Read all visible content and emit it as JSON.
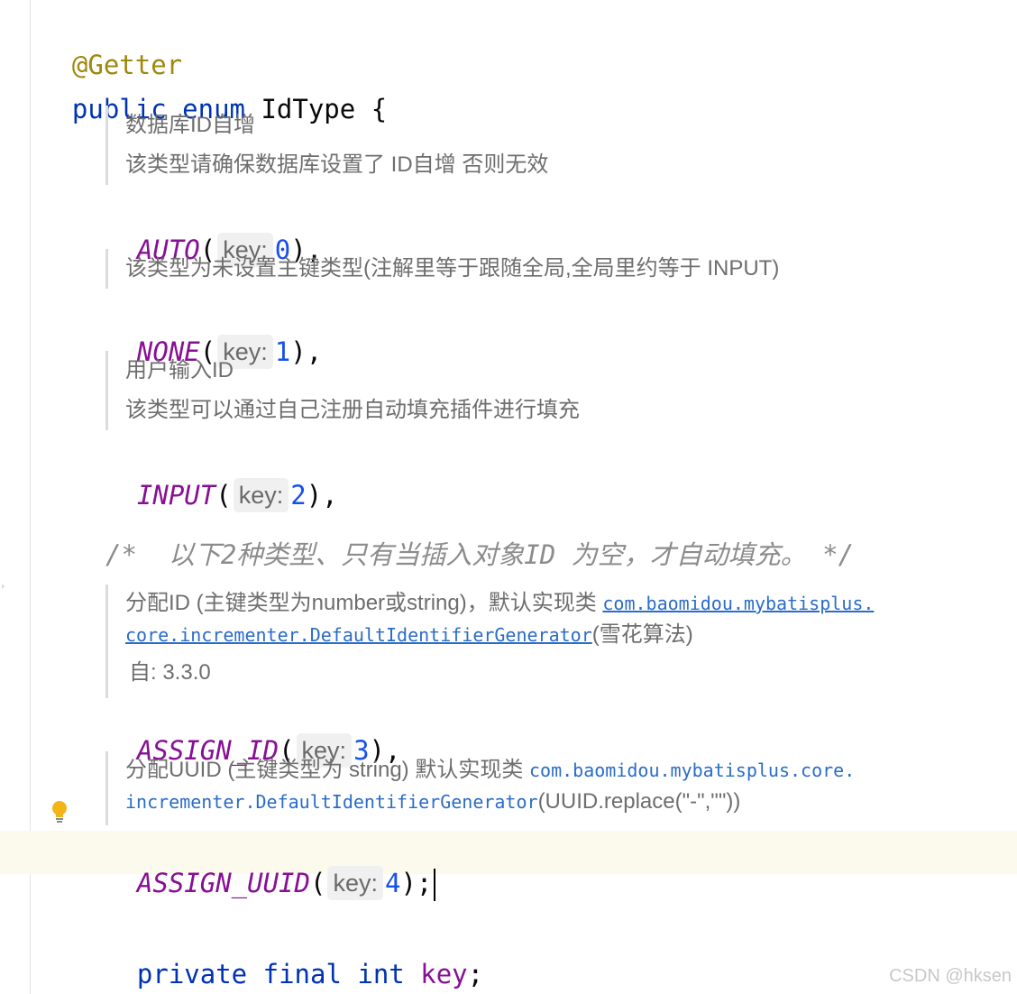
{
  "code": {
    "annotation": "@Getter",
    "decl_public": "public",
    "decl_enum": "enum",
    "decl_name": "IdType",
    "decl_brace": " {",
    "hint_label": "key:",
    "constants": [
      {
        "name": "AUTO",
        "value": "0",
        "terminator": "),"
      },
      {
        "name": "NONE",
        "value": "1",
        "terminator": "),"
      },
      {
        "name": "INPUT",
        "value": "2",
        "terminator": "),"
      },
      {
        "name": "ASSIGN_ID",
        "value": "3",
        "terminator": "),"
      },
      {
        "name": "ASSIGN_UUID",
        "value": "4",
        "terminator": ");"
      }
    ],
    "comment": "/*  以下2种类型、只有当插入对象ID 为空，才自动填充。 */",
    "field_private": "private",
    "field_final": "final",
    "field_int": "int",
    "field_name": "key",
    "field_semicolon": ";"
  },
  "docs": {
    "auto": [
      "数据库ID自增",
      "该类型请确保数据库设置了 ID自增 否则无效"
    ],
    "none": [
      "该类型为未设置主键类型(注解里等于跟随全局,全局里约等于 INPUT)"
    ],
    "input": [
      "用户输入ID",
      "该类型可以通过自己注册自动填充插件进行填充"
    ],
    "assign_id": {
      "prefix": "分配ID (主键类型为number或string)，默认实现类 ",
      "link1": "com.baomidou.mybatisplus.",
      "link2": "core.incrementer.DefaultIdentifierGenerator",
      "suffix": "(雪花算法)",
      "since": "自: 3.3.0"
    },
    "assign_uuid": {
      "prefix": "分配UUID (主键类型为 string) 默认实现类 ",
      "code1": "com.baomidou.mybatisplus.core.",
      "code2": "incrementer.DefaultIdentifierGenerator",
      "suffix": "(UUID.replace(\"-\",\"\"))"
    }
  },
  "icons": {
    "intention": "lightbulb-icon"
  },
  "watermark": "CSDN @hksen",
  "colors": {
    "keyword": "#0033b3",
    "annotation": "#9e880d",
    "constant": "#871094",
    "number": "#1750eb",
    "comment": "#8c8c8c",
    "caret_line": "#fcfaed"
  }
}
